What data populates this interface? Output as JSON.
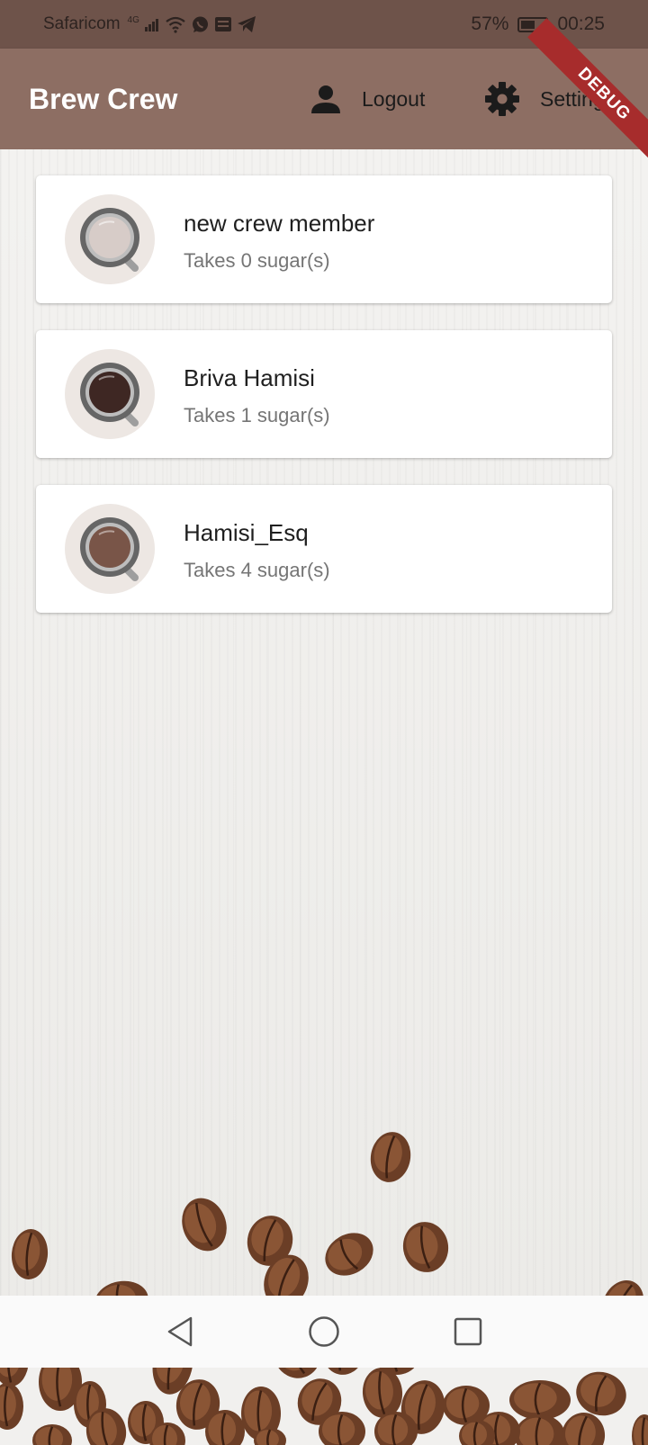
{
  "status_bar": {
    "carrier": "Safaricom",
    "network": "4G",
    "battery": "57%",
    "battery_level": 0.57,
    "time": "00:25"
  },
  "app_bar": {
    "title": "Brew Crew",
    "logout_label": "Logout",
    "settings_label": "Settings",
    "debug_banner": "DEBUG"
  },
  "crew": [
    {
      "name": "new crew member",
      "subtitle": "Takes 0 sugar(s)",
      "coffee_color": "#d7ccc8"
    },
    {
      "name": "Briva Hamisi",
      "subtitle": "Takes 1 sugar(s)",
      "coffee_color": "#3e2723"
    },
    {
      "name": "Hamisi_Esq",
      "subtitle": "Takes 4 sugar(s)",
      "coffee_color": "#795548"
    }
  ],
  "colors": {
    "app_bar": "#8d6e63",
    "status_bar": "#6e534a",
    "debug": "#a72c2c"
  },
  "icons": {
    "logout": "person-icon",
    "settings": "gear-icon",
    "nav_back": "back-triangle-icon",
    "nav_home": "home-circle-icon",
    "nav_recents": "recents-square-icon"
  }
}
